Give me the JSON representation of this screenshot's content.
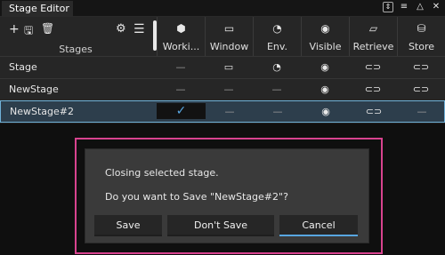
{
  "window": {
    "title": "Stage Editor"
  },
  "top_icons": [
    "dock-icon",
    "menu-icon",
    "minimize-icon",
    "close-icon"
  ],
  "toolbar": {
    "stages_label": "Stages",
    "icons": [
      "add-icon",
      "save-icon",
      "delete-icon",
      "settings-icon",
      "list-icon"
    ]
  },
  "columns": [
    {
      "label": "Worki...",
      "icon": "cube-icon"
    },
    {
      "label": "Window",
      "icon": "camera-icon"
    },
    {
      "label": "Env.",
      "icon": "gauge-icon"
    },
    {
      "label": "Visible",
      "icon": "eye-icon"
    },
    {
      "label": "Retrieve",
      "icon": "folder-icon"
    },
    {
      "label": "Store",
      "icon": "database-icon"
    }
  ],
  "rows": [
    {
      "name": "Stage",
      "cells": [
        "—",
        "camera",
        "shape",
        "eye",
        "link",
        "link"
      ]
    },
    {
      "name": "NewStage",
      "cells": [
        "—",
        "—",
        "—",
        "eye",
        "link",
        "link"
      ]
    },
    {
      "name": "NewStage#2",
      "cells": [
        "✓",
        "—",
        "—",
        "eye",
        "link",
        "—"
      ],
      "selected": true
    }
  ],
  "dialog": {
    "message": "Closing selected stage.",
    "question": "Do you want to Save \"NewStage#2\"?",
    "save_button": "Save",
    "dont_save_button": "Don't Save",
    "cancel_button": "Cancel"
  }
}
